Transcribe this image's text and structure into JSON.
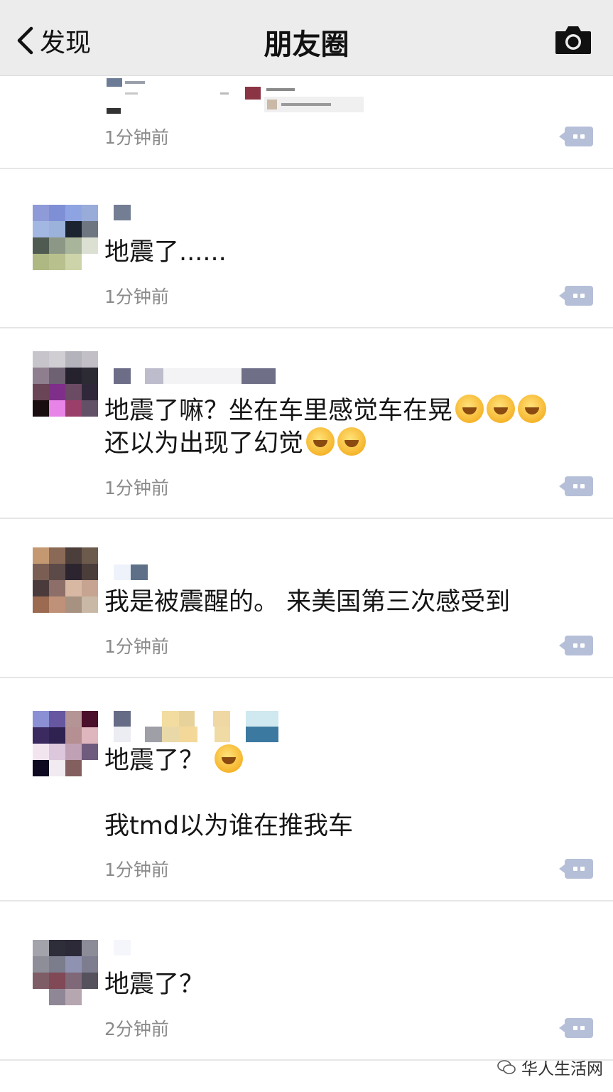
{
  "header": {
    "back_label": "发现",
    "title": "朋友圈",
    "icons": {
      "back": "chevron-left-icon",
      "camera": "camera-icon"
    }
  },
  "partial_post": {
    "time": "1分钟前"
  },
  "posts": [
    {
      "lines": [
        "地震了......"
      ],
      "time": "1分钟前"
    },
    {
      "lines": [
        "地震了嘛？坐在车里感觉车在晃",
        "还以为出现了幻觉"
      ],
      "time": "1分钟前",
      "emoji": "face-with-tears-of-joy"
    },
    {
      "lines": [
        "我是被震醒的。 来美国第三次感受到"
      ],
      "time": "1分钟前"
    },
    {
      "lines": [
        "地震了？",
        "",
        "我tmd以为谁在推我车"
      ],
      "time": "1分钟前",
      "emoji": "face-with-tears-of-joy"
    },
    {
      "lines": [
        "地震了？"
      ],
      "time": "2分钟前"
    }
  ],
  "watermark": {
    "text": "华人生活网"
  },
  "colors": {
    "header_bg": "#ececec",
    "comment_button": "#b5bfd8",
    "time_text": "#8a8a8a"
  }
}
